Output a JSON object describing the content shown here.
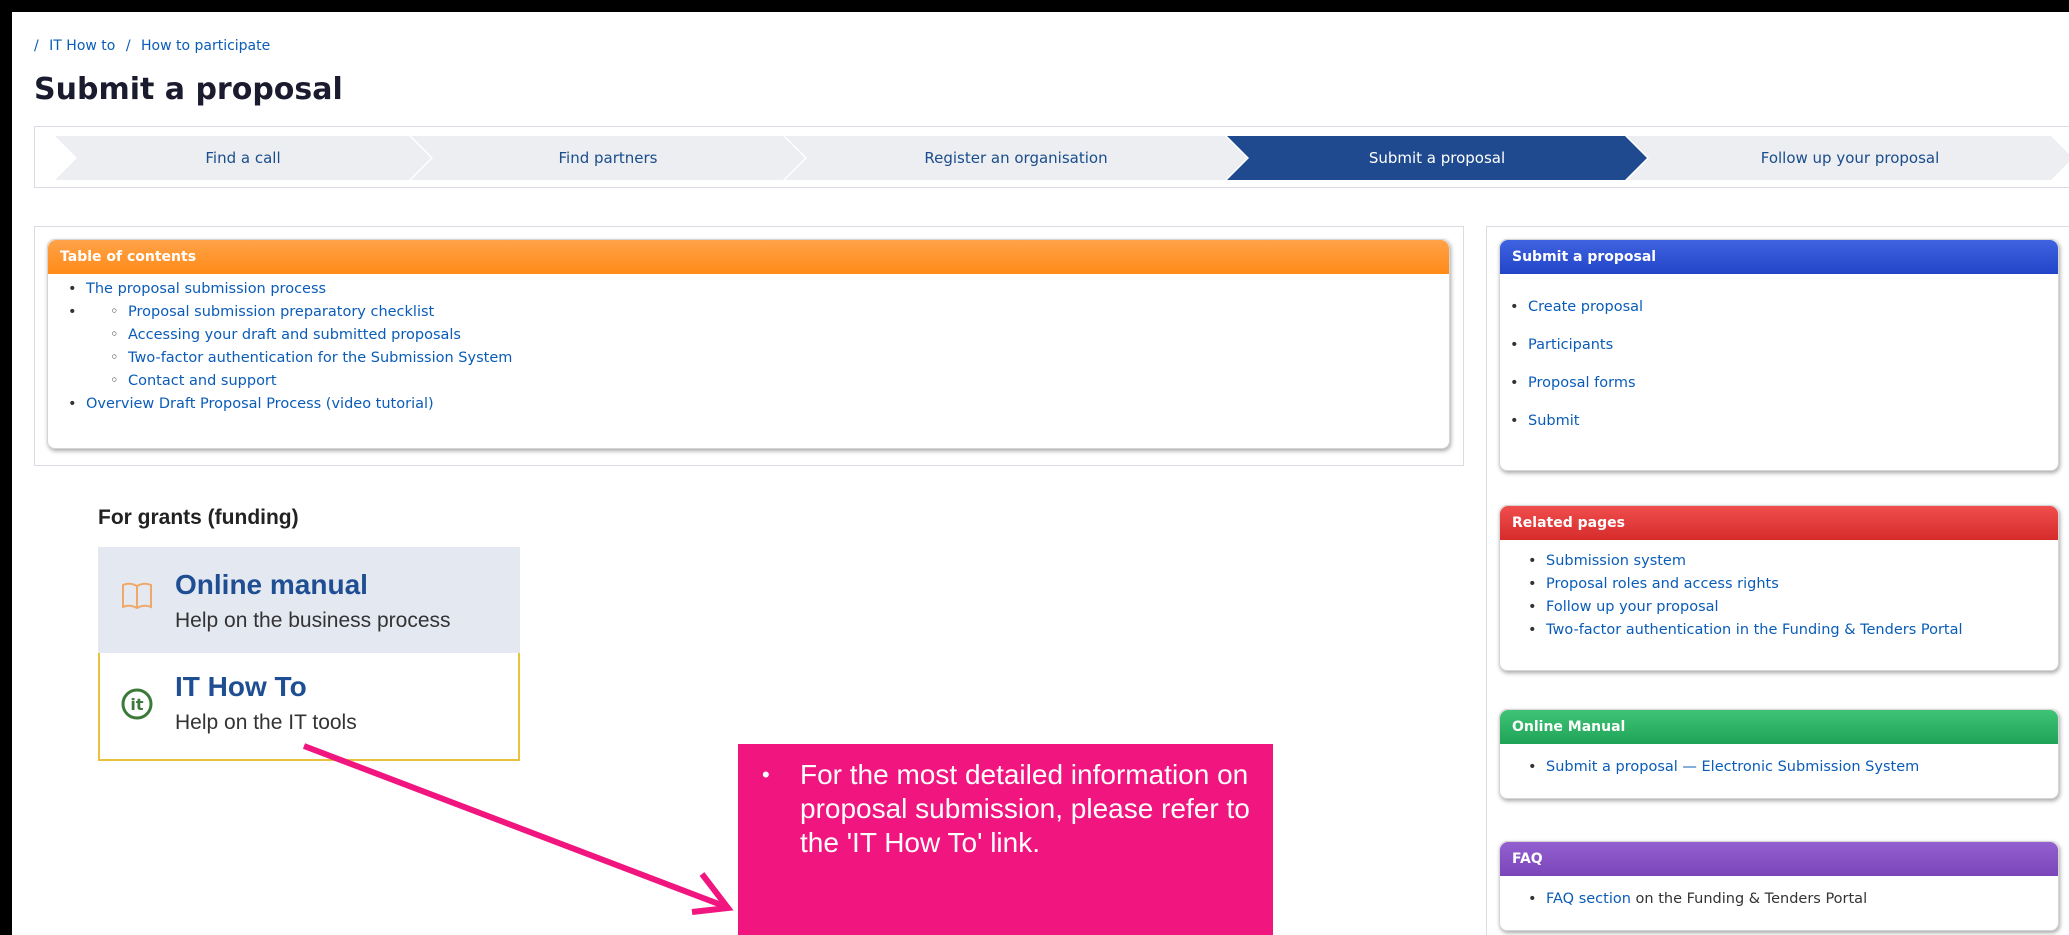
{
  "breadcrumb": {
    "items": [
      "/",
      "IT How to",
      "/",
      "How to participate"
    ]
  },
  "page_title": "Submit a proposal",
  "stepper": {
    "steps": [
      "Find a call",
      "Find partners",
      "Register an organisation",
      "Submit a proposal",
      "Follow up your proposal"
    ],
    "active": "Submit a proposal"
  },
  "toc": {
    "header": "Table of contents",
    "items": [
      "The proposal submission process",
      "Proposal submission preparatory checklist",
      "Accessing your draft and submitted proposals",
      "Two-factor authentication for the Submission System",
      "Contact and support",
      "Overview Draft Proposal Process (video tutorial)"
    ]
  },
  "grants": {
    "title": "For grants (funding)",
    "online_manual": {
      "title": "Online manual",
      "subtitle": "Help on the business process",
      "icon": "book-icon"
    },
    "it_how_to": {
      "title": "IT How To",
      "subtitle": "Help on the IT tools",
      "icon": "it-icon"
    }
  },
  "callout": {
    "bullet": "•",
    "text": "For the most detailed information on proposal submission, please refer to the 'IT How To' link."
  },
  "side": {
    "submit": {
      "header": "Submit a proposal",
      "items": [
        "Create proposal",
        "Participants",
        "Proposal forms",
        "Submit"
      ]
    },
    "related": {
      "header": "Related pages",
      "items": [
        "Submission system",
        "Proposal roles and access rights",
        "Follow up your proposal",
        "Two-factor authentication in the Funding & Tenders Portal"
      ]
    },
    "manual": {
      "header": "Online Manual",
      "items": [
        "Submit a proposal — Electronic Submission System"
      ]
    },
    "faq": {
      "header": "FAQ",
      "link": "FAQ section",
      "suffix": " on the Funding & Tenders Portal"
    }
  },
  "colors": {
    "stepper_active": "#1f4a8f",
    "callout": "#f0157f",
    "toc_header": "#ff8a17",
    "submit_header": "#2244c8",
    "related_header": "#d62b2b",
    "manual_header": "#1fa356",
    "faq_header": "#7a45b9"
  }
}
